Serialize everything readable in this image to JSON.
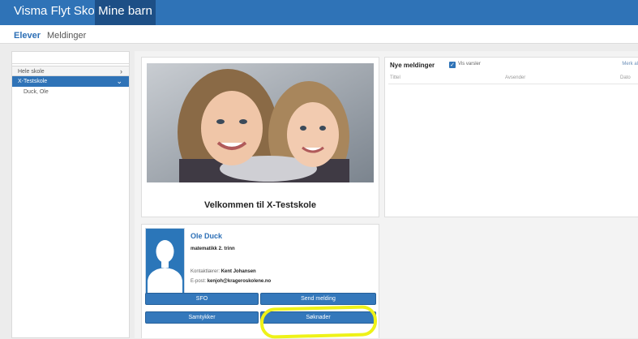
{
  "app": {
    "brand": "Visma Flyt Skole",
    "nav_active": "Mine barn"
  },
  "subnav": {
    "elever": "Elever",
    "meldinger": "Meldinger"
  },
  "sidebar": {
    "items": [
      {
        "label": "Hele skole"
      },
      {
        "label": "X-Testskole"
      },
      {
        "label": "Duck, Ole"
      }
    ]
  },
  "welcome": {
    "title": "Velkommen til X-Testskole"
  },
  "messages": {
    "title": "Nye meldinger",
    "show_notices": "Vis varsler",
    "mark_all": "Merk al",
    "columns": [
      "Tittel",
      "Avsender",
      "Dato"
    ]
  },
  "student": {
    "name": "Ole Duck",
    "class": "matematikk 2. trinn",
    "contact_label": "Kontaktlærer:",
    "contact_name": "Kent Johansen",
    "email_label": "E-post:",
    "email": "kenjoh@krageroskolene.no"
  },
  "buttons": {
    "sfo": "SFO",
    "send_message": "Send melding",
    "consents": "Samtykker",
    "applications": "Søknader"
  },
  "colors": {
    "brand_blue": "#2f73b7",
    "nav_dark": "#1d4f86",
    "highlight": "#eef218"
  }
}
